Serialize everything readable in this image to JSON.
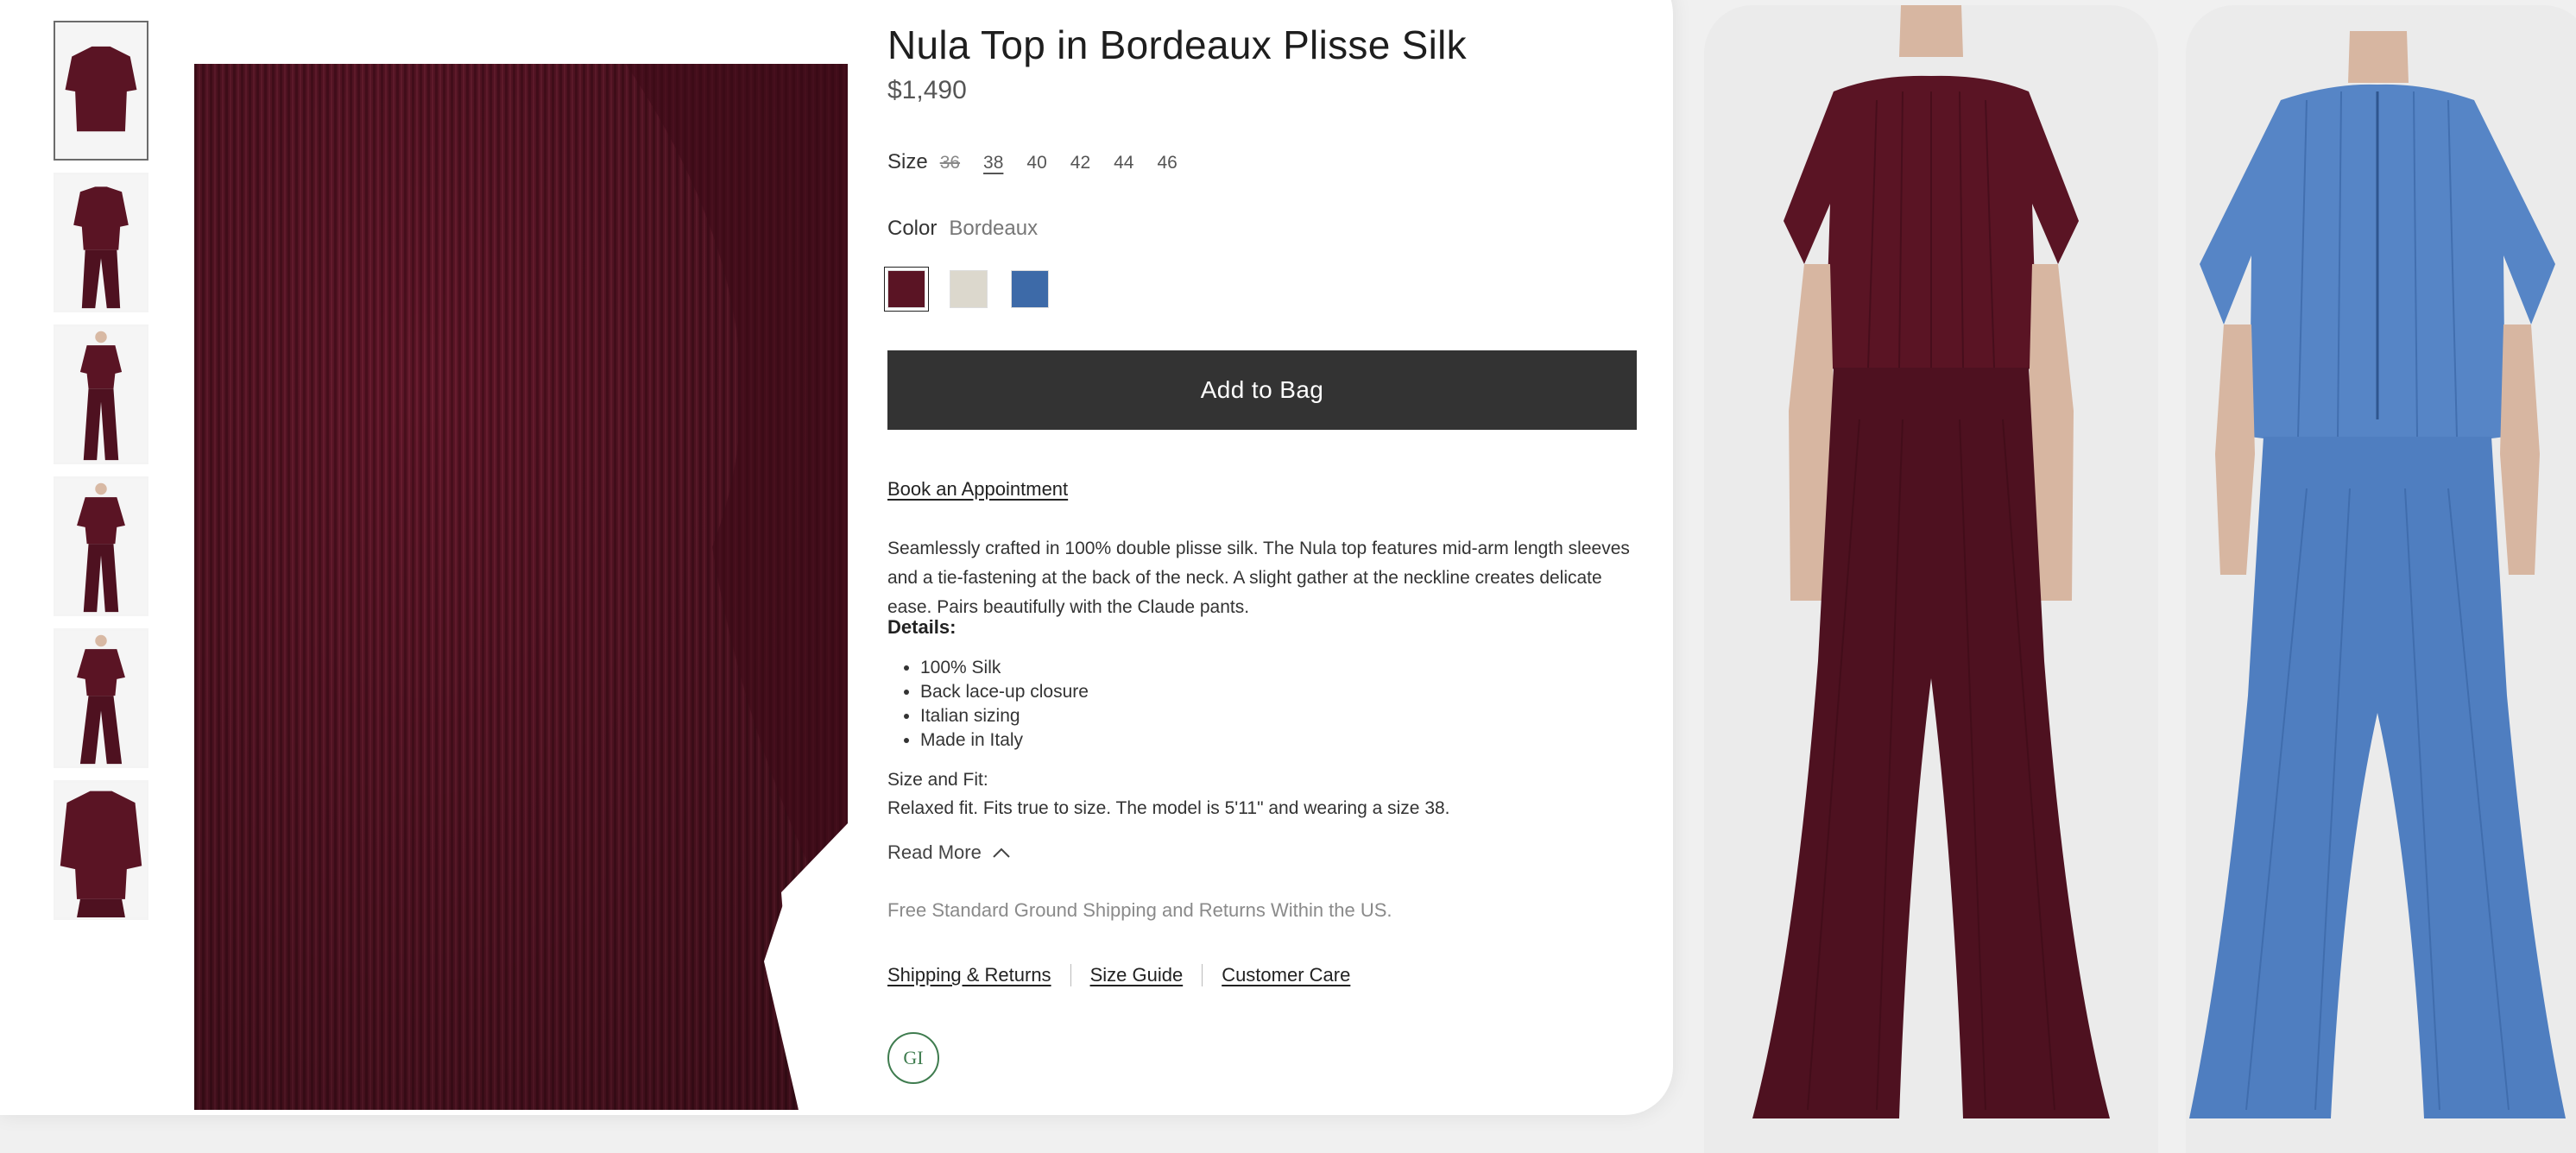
{
  "product": {
    "title": "Nula Top in Bordeaux Plisse Silk",
    "price": "$1,490"
  },
  "size": {
    "label": "Size",
    "options": [
      {
        "label": "36",
        "state": "unavailable"
      },
      {
        "label": "38",
        "state": "selected"
      },
      {
        "label": "40",
        "state": "available"
      },
      {
        "label": "42",
        "state": "available"
      },
      {
        "label": "44",
        "state": "available"
      },
      {
        "label": "46",
        "state": "available"
      }
    ]
  },
  "color": {
    "label": "Color",
    "value": "Bordeaux",
    "swatches": [
      {
        "name": "bordeaux",
        "hex": "#5a1424",
        "selected": true
      },
      {
        "name": "ivory",
        "hex": "#dcd8cd",
        "selected": false
      },
      {
        "name": "blue",
        "hex": "#3d6aa8",
        "selected": false
      }
    ]
  },
  "actions": {
    "add_to_bag": "Add to Bag",
    "book_appointment": "Book an Appointment"
  },
  "description": "Seamlessly crafted in 100% double plisse silk. The Nula top features mid-arm length sleeves and a tie-fastening at the back of the neck. A slight gather at the neckline creates delicate ease. Pairs beautifully with the Claude pants.",
  "details": {
    "heading": "Details:",
    "items": [
      "100% Silk",
      "Back lace-up closure",
      "Italian sizing",
      "Made in Italy"
    ]
  },
  "fit": {
    "heading": "Size and Fit:",
    "text": "Relaxed fit. Fits true to size. The model is 5'11\" and wearing a size 38."
  },
  "read_more": "Read More",
  "shipping_note": "Free Standard Ground Shipping and Returns Within the US.",
  "footer_links": [
    "Shipping & Returns",
    "Size Guide",
    "Customer Care"
  ],
  "badge_text": "GI",
  "colors": {
    "bordeaux": "#5a1424",
    "button_bg": "#333333",
    "blue_fabric": "#4f7ec0",
    "badge_green": "#3f7c4f"
  }
}
